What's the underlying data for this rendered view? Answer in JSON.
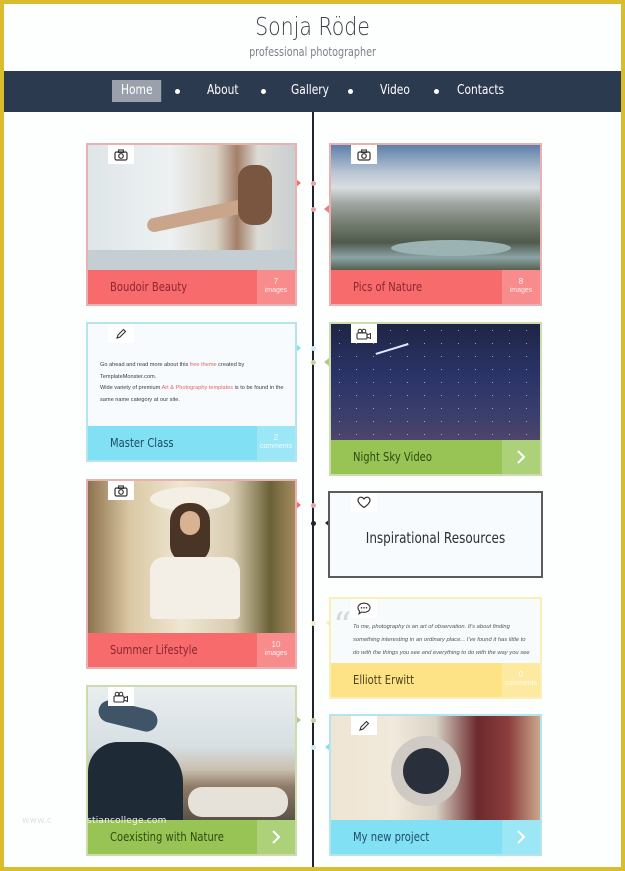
{
  "header": {
    "title": "Sonja Röde",
    "subtitle": "professional photographer"
  },
  "nav": {
    "items": [
      {
        "label": "Home",
        "active": true
      },
      {
        "label": "About",
        "active": false
      },
      {
        "label": "Gallery",
        "active": false
      },
      {
        "label": "Video",
        "active": false
      },
      {
        "label": "Contacts",
        "active": false
      }
    ]
  },
  "colors": {
    "pink": "#f76b6c",
    "cyan": "#81e0f3",
    "green": "#97c454",
    "yellow": "#fde386",
    "navbar": "#2c3a50",
    "frame": "#d9bd2e"
  },
  "posts": [
    {
      "id": "boudoir",
      "title": "Boudoir Beauty",
      "icon": "camera-icon",
      "count": "7",
      "count_label": "images",
      "color": "pink"
    },
    {
      "id": "nature",
      "title": "Pics of Nature",
      "icon": "camera-icon",
      "count": "8",
      "count_label": "images",
      "color": "pink"
    },
    {
      "id": "master",
      "title": "Master Class",
      "icon": "pencil-icon",
      "count": "2",
      "count_label": "comments",
      "color": "cyan",
      "text": {
        "p1_before": "Go ahead and read more about this ",
        "p1_link": "free theme",
        "p1_after": " created by TemplateMonster.com.",
        "p2_before": "Wide variety of premium ",
        "p2_link": "Art & Photography templates",
        "p2_after": " is to be found in the same name category at our site."
      }
    },
    {
      "id": "nightsky",
      "title": "Night Sky Video",
      "icon": "video-camera-icon",
      "color": "green"
    },
    {
      "id": "summer",
      "title": "Summer Lifestyle",
      "icon": "camera-icon",
      "count": "10",
      "count_label": "images",
      "color": "pink"
    },
    {
      "id": "inspire",
      "title": "Inspirational Resources",
      "icon": "heart-icon"
    },
    {
      "id": "quote",
      "title": "Elliott Erwitt",
      "icon": "speech-bubble-icon",
      "count": "0",
      "count_label": "comments",
      "color": "yellow",
      "text": "To me, photography is an art of observation. It's about finding something interesting in an ordinary place... I've found it has little to do with the things you see and everything to do with the way you see them."
    },
    {
      "id": "coexisting",
      "title": "Coexisting with Nature",
      "icon": "video-camera-icon",
      "color": "green"
    },
    {
      "id": "project",
      "title": "My new project",
      "icon": "pencil-icon",
      "color": "cyan"
    }
  ],
  "watermark": {
    "faint": "www.c",
    "text": "agechristiancollege.com"
  }
}
